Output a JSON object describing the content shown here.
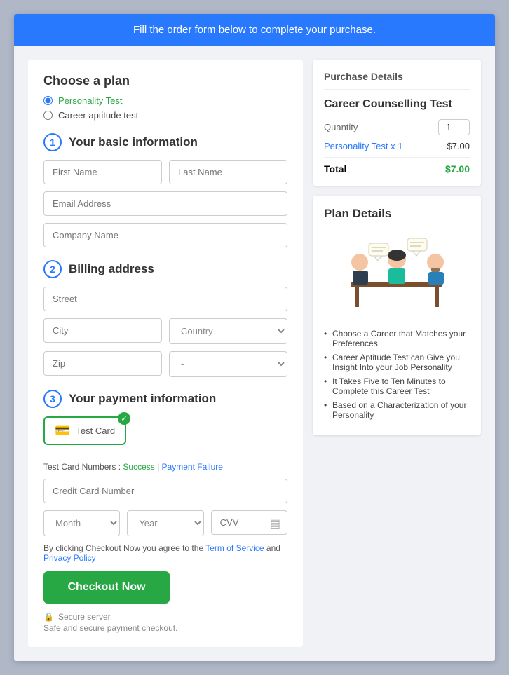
{
  "banner": {
    "text": "Fill the order form below to complete your purchase."
  },
  "left": {
    "choose_plan_title": "Choose a plan",
    "plans": [
      {
        "id": "personality",
        "label": "Personality Test",
        "selected": true
      },
      {
        "id": "career",
        "label": "Career aptitude test",
        "selected": false
      }
    ],
    "step1": {
      "number": "1",
      "title": "Your basic information",
      "first_name_placeholder": "First Name",
      "last_name_placeholder": "Last Name",
      "email_placeholder": "Email Address",
      "company_placeholder": "Company Name"
    },
    "step2": {
      "number": "2",
      "title": "Billing address",
      "street_placeholder": "Street",
      "city_placeholder": "City",
      "country_placeholder": "Country",
      "zip_placeholder": "Zip",
      "state_placeholder": "-"
    },
    "step3": {
      "number": "3",
      "title": "Your payment information",
      "card_label": "Test Card",
      "test_card_label": "Test Card Numbers :",
      "success_link": "Success",
      "failure_link": "Payment Failure",
      "cc_number_placeholder": "Credit Card Number",
      "month_placeholder": "Month",
      "year_placeholder": "Year",
      "cvv_placeholder": "CVV"
    },
    "checkout_notice": "By clicking Checkout Now you agree to the ",
    "terms_label": "Term of Service",
    "and_label": " and ",
    "privacy_label": "Privacy Policy",
    "checkout_btn": "Checkout Now",
    "secure_label": "Secure server",
    "secure_desc": "Safe and secure payment checkout."
  },
  "right": {
    "purchase_details": {
      "header": "Purchase Details",
      "product_name": "Career Counselling Test",
      "quantity_label": "Quantity",
      "quantity_value": "1",
      "item_label": "Personality Test x 1",
      "item_price": "$7.00",
      "total_label": "Total",
      "total_price": "$7.00"
    },
    "plan_details": {
      "title": "Plan Details",
      "bullets": [
        "Choose a Career that Matches your Preferences",
        "Career Aptitude Test can Give you Insight Into your Job Personality",
        "It Takes Five to Ten Minutes to Complete this Career Test",
        "Based on a Characterization of your Personality"
      ]
    }
  }
}
